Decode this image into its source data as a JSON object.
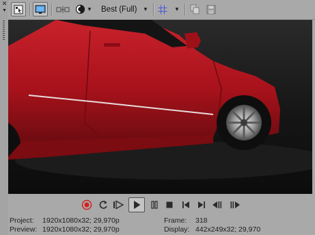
{
  "window": {
    "close_glyph": "✕",
    "pin_glyph": "▼"
  },
  "toolbar": {
    "quality_label": "Best (Full)",
    "icons": [
      "preview-settings-icon",
      "monitor-icon",
      "split-screen-icon",
      "overlay-icon",
      "grid-icon",
      "copy-snapshot-icon",
      "save-snapshot-icon"
    ]
  },
  "transport": {
    "buttons": [
      "record",
      "loop",
      "play-from-start",
      "play",
      "pause",
      "stop",
      "go-to-start",
      "go-to-end",
      "previous-frame",
      "next-frame"
    ]
  },
  "status": {
    "project_label": "Project:",
    "project_value": "1920x1080x32; 29,970p",
    "preview_label": "Preview:",
    "preview_value": "1920x1080x32; 29,970p",
    "frame_label": "Frame:",
    "frame_value": "318",
    "display_label": "Display:",
    "display_value": "442x249x32; 29,970"
  },
  "colors": {
    "panel": "#a9a9a9",
    "record_red": "#d42020",
    "grid_blue": "#4a58d8",
    "car_red": "#b8141e"
  }
}
